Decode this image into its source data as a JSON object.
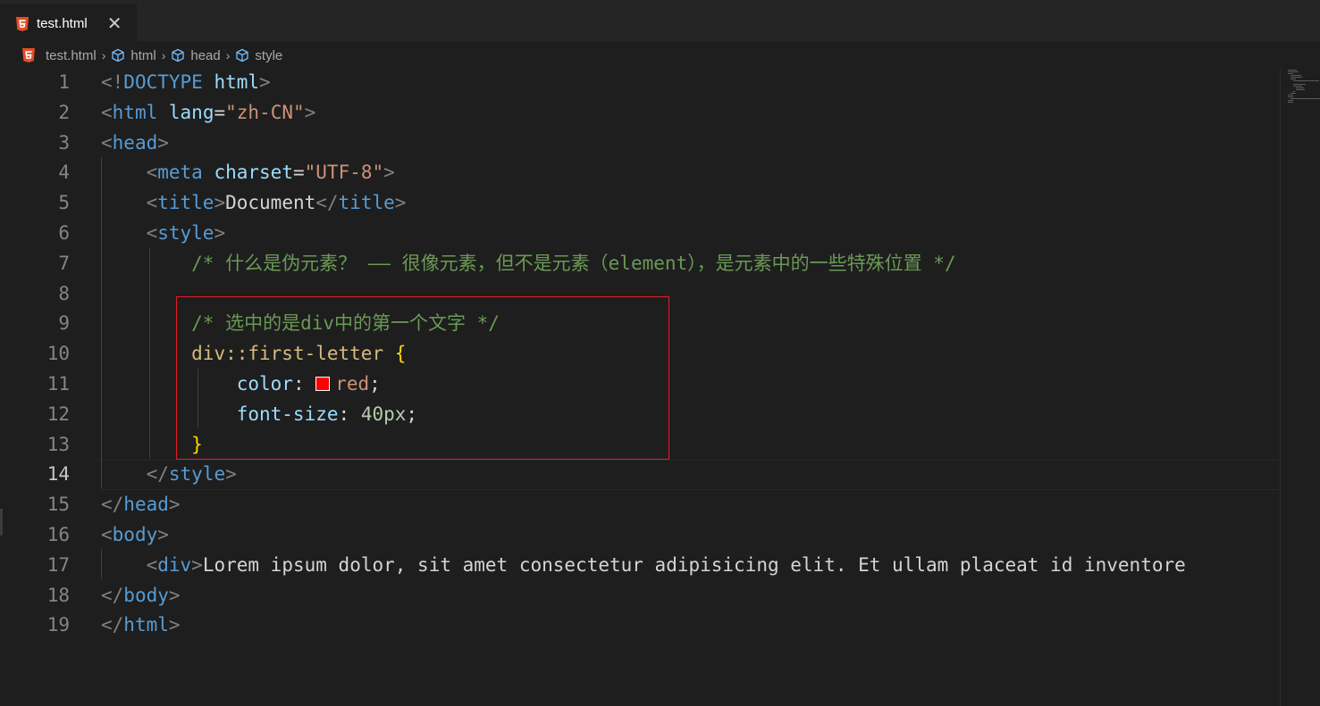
{
  "tab": {
    "label": "test.html",
    "close": "✕"
  },
  "breadcrumb": {
    "file": "test.html",
    "items": [
      "html",
      "head",
      "style"
    ]
  },
  "editor": {
    "line_numbers": [
      "1",
      "2",
      "3",
      "4",
      "5",
      "6",
      "7",
      "8",
      "9",
      "10",
      "11",
      "12",
      "13",
      "14",
      "15",
      "16",
      "17",
      "18",
      "19"
    ],
    "active_line": "14",
    "lines": [
      [
        {
          "c": "tag",
          "t": "<!"
        },
        {
          "c": "tn",
          "t": "DOCTYPE"
        },
        {
          "c": "txt",
          "t": " "
        },
        {
          "c": "attr",
          "t": "html"
        },
        {
          "c": "tag",
          "t": ">"
        }
      ],
      [
        {
          "c": "tag",
          "t": "<"
        },
        {
          "c": "tn",
          "t": "html"
        },
        {
          "c": "txt",
          "t": " "
        },
        {
          "c": "attr",
          "t": "lang"
        },
        {
          "c": "txt",
          "t": "="
        },
        {
          "c": "str",
          "t": "\"zh-CN\""
        },
        {
          "c": "tag",
          "t": ">"
        }
      ],
      [
        {
          "c": "tag",
          "t": "<"
        },
        {
          "c": "tn",
          "t": "head"
        },
        {
          "c": "tag",
          "t": ">"
        }
      ],
      [
        {
          "c": "txt",
          "t": "    "
        },
        {
          "c": "tag",
          "t": "<"
        },
        {
          "c": "tn",
          "t": "meta"
        },
        {
          "c": "txt",
          "t": " "
        },
        {
          "c": "attr",
          "t": "charset"
        },
        {
          "c": "txt",
          "t": "="
        },
        {
          "c": "str",
          "t": "\"UTF-8\""
        },
        {
          "c": "tag",
          "t": ">"
        }
      ],
      [
        {
          "c": "txt",
          "t": "    "
        },
        {
          "c": "tag",
          "t": "<"
        },
        {
          "c": "tn",
          "t": "title"
        },
        {
          "c": "tag",
          "t": ">"
        },
        {
          "c": "txt",
          "t": "Document"
        },
        {
          "c": "tag",
          "t": "</"
        },
        {
          "c": "tn",
          "t": "title"
        },
        {
          "c": "tag",
          "t": ">"
        }
      ],
      [
        {
          "c": "txt",
          "t": "    "
        },
        {
          "c": "tag",
          "t": "<"
        },
        {
          "c": "tn",
          "t": "style"
        },
        {
          "c": "tag",
          "t": ">"
        }
      ],
      [
        {
          "c": "txt",
          "t": "        "
        },
        {
          "c": "cm",
          "t": "/* 什么是伪元素？ —— 很像元素，但不是元素（element），是元素中的一些特殊位置 */"
        }
      ],
      [],
      [
        {
          "c": "txt",
          "t": "        "
        },
        {
          "c": "cm",
          "t": "/* 选中的是div中的第一个文字 */"
        }
      ],
      [
        {
          "c": "txt",
          "t": "        "
        },
        {
          "c": "sel",
          "t": "div::first-letter"
        },
        {
          "c": "txt",
          "t": " "
        },
        {
          "c": "br",
          "t": "{"
        }
      ],
      [
        {
          "c": "txt",
          "t": "            "
        },
        {
          "c": "prop",
          "t": "color"
        },
        {
          "c": "txt",
          "t": ": "
        },
        {
          "c": "swatch",
          "t": ""
        },
        {
          "c": "str",
          "t": "red"
        },
        {
          "c": "txt",
          "t": ";"
        }
      ],
      [
        {
          "c": "txt",
          "t": "            "
        },
        {
          "c": "prop",
          "t": "font-size"
        },
        {
          "c": "txt",
          "t": ": "
        },
        {
          "c": "num",
          "t": "40px"
        },
        {
          "c": "txt",
          "t": ";"
        }
      ],
      [
        {
          "c": "txt",
          "t": "        "
        },
        {
          "c": "br",
          "t": "}"
        }
      ],
      [
        {
          "c": "txt",
          "t": "    "
        },
        {
          "c": "tag",
          "t": "</"
        },
        {
          "c": "tn",
          "t": "style"
        },
        {
          "c": "tag",
          "t": ">"
        }
      ],
      [
        {
          "c": "tag",
          "t": "</"
        },
        {
          "c": "tn",
          "t": "head"
        },
        {
          "c": "tag",
          "t": ">"
        }
      ],
      [
        {
          "c": "tag",
          "t": "<"
        },
        {
          "c": "tn",
          "t": "body"
        },
        {
          "c": "tag",
          "t": ">"
        }
      ],
      [
        {
          "c": "txt",
          "t": "    "
        },
        {
          "c": "tag",
          "t": "<"
        },
        {
          "c": "tn",
          "t": "div"
        },
        {
          "c": "tag",
          "t": ">"
        },
        {
          "c": "txt",
          "t": "Lorem ipsum dolor, sit amet consectetur adipisicing elit. Et ullam placeat id inventore"
        }
      ],
      [
        {
          "c": "tag",
          "t": "</"
        },
        {
          "c": "tn",
          "t": "body"
        },
        {
          "c": "tag",
          "t": ">"
        }
      ],
      [
        {
          "c": "tag",
          "t": "</"
        },
        {
          "c": "tn",
          "t": "html"
        },
        {
          "c": "tag",
          "t": ">"
        }
      ]
    ]
  },
  "colors": {
    "html5_icon": "#e44d26",
    "highlight_box": "#e51c23",
    "swatch": "#ff0000"
  }
}
